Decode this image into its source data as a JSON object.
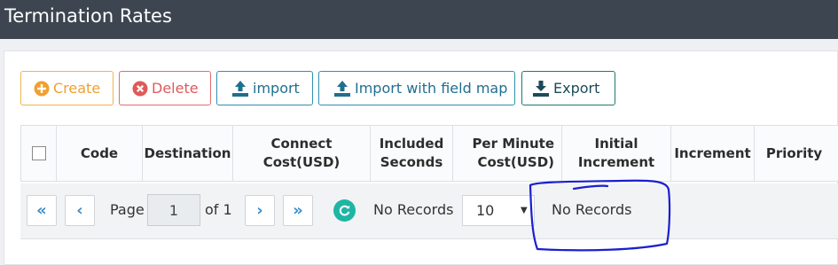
{
  "header": {
    "title": "Termination Rates"
  },
  "toolbar": {
    "create": "Create",
    "delete": "Delete",
    "import": "import",
    "import_field_map": "Import with field map",
    "export": "Export"
  },
  "table": {
    "columns": [
      "Code",
      "Destination",
      "Connect Cost(USD)",
      "Included Seconds",
      "Per Minute Cost(USD)",
      "Initial Increment",
      "Increment",
      "Priority"
    ]
  },
  "pager": {
    "page_label": "Page",
    "page_value": "1",
    "of_label": "of 1",
    "status": "No Records",
    "page_size": "10",
    "records_info": "No Records"
  },
  "colors": {
    "header_bg": "#3d4650",
    "create": "#f0a030",
    "delete": "#e05a5a",
    "import": "#1f6f90",
    "export": "#1c4a5a",
    "refresh": "#1fb5a4",
    "annotation": "#1a1fd0"
  },
  "icons": {
    "create": "plus-circle-icon",
    "delete": "times-circle-icon",
    "import": "upload-icon",
    "export": "download-icon",
    "refresh": "refresh-icon",
    "first": "double-chevron-left-icon",
    "prev": "chevron-left-icon",
    "next": "chevron-right-icon",
    "last": "double-chevron-right-icon"
  }
}
